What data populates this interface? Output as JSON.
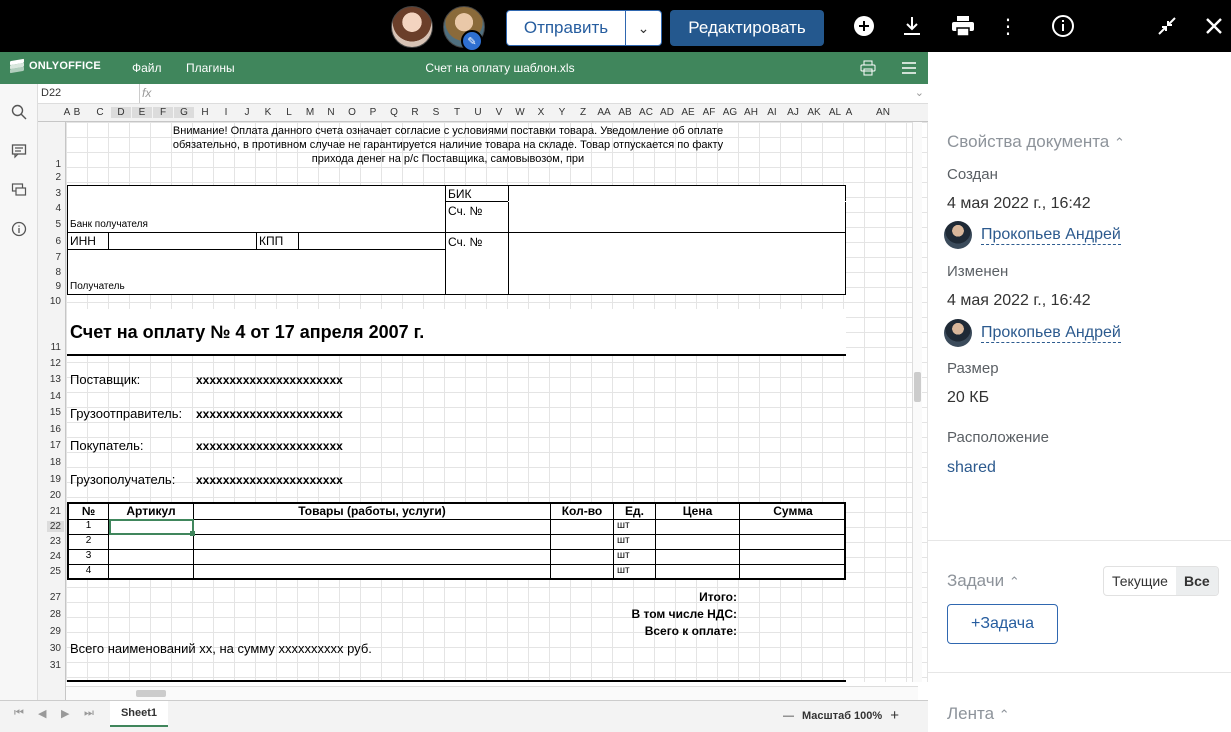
{
  "topbar": {
    "send_label": "Отправить",
    "edit_label": "Редактировать"
  },
  "editor": {
    "logo_text": "ONLYOFFICE",
    "menu": [
      "Файл",
      "Плагины"
    ],
    "doc_title": "Счет на оплату шаблон.xls",
    "cell_ref": "D22",
    "fx": "fx"
  },
  "columns": [
    "A",
    "B",
    "C",
    "D",
    "E",
    "F",
    "G",
    "H",
    "I",
    "J",
    "K",
    "L",
    "M",
    "N",
    "O",
    "P",
    "Q",
    "R",
    "S",
    "T",
    "U",
    "V",
    "W",
    "X",
    "Y",
    "Z",
    "AA",
    "AB",
    "AC",
    "AD",
    "AE",
    "AF",
    "AG",
    "AH",
    "AI",
    "AJ",
    "AK",
    "AL",
    "A",
    "AN"
  ],
  "rows": [
    "1",
    "2",
    "3",
    "4",
    "5",
    "6",
    "7",
    "8",
    "9",
    "10",
    "11",
    "12",
    "13",
    "14",
    "15",
    "16",
    "17",
    "18",
    "19",
    "20",
    "21",
    "22",
    "23",
    "24",
    "25",
    "27",
    "28",
    "29",
    "30",
    "31"
  ],
  "sheet": {
    "notice_1": "Внимание! Оплата данного счета означает согласие с условиями поставки товара. Уведомление об оплате",
    "notice_2": "обязательно, в противном случае не гарантируется наличие товара на складе. Товар отпускается по факту",
    "notice_3": "прихода денег на р/с Поставщика, самовывозом, при",
    "bik": "БИК",
    "sch1": "Сч. №",
    "bank": "Банк получателя",
    "inn": "ИНН",
    "kpp": "КПП",
    "sch2": "Сч. №",
    "recipient": "Получатель",
    "invoice_title": "Счет на оплату № 4 от 17 апреля 2007 г.",
    "supplier_label": "Поставщик:",
    "supplier_value": "xxxxxxxxxxxxxxxxxxxxxx",
    "shipper_label": "Грузоотправитель:",
    "shipper_value": "xxxxxxxxxxxxxxxxxxxxxx",
    "buyer_label": "Покупатель:",
    "buyer_value": "xxxxxxxxxxxxxxxxxxxxxx",
    "consignee_label": "Грузополучатель:",
    "consignee_value": "xxxxxxxxxxxxxxxxxxxxxx",
    "table_headers": [
      "№",
      "Артикул",
      "Товары (работы, услуги)",
      "Кол-во",
      "Ед.",
      "Цена",
      "Сумма"
    ],
    "table_rows": [
      {
        "n": "1",
        "unit": "шт"
      },
      {
        "n": "2",
        "unit": "шт"
      },
      {
        "n": "3",
        "unit": "шт"
      },
      {
        "n": "4",
        "unit": "шт"
      }
    ],
    "total": "Итого:",
    "vat": "В том числе НДС:",
    "grand_total": "Всего к оплате:",
    "summary": "Всего наименований xx, на сумму xxxxxxxxxx руб."
  },
  "statusbar": {
    "sheet_tab": "Sheet1",
    "zoom_label": "Масштаб 100%",
    "zoom_minus": "—",
    "zoom_plus": "+"
  },
  "panel": {
    "props_title": "Свойства документа",
    "created_label": "Создан",
    "created_value": "4 мая 2022 г., 16:42",
    "created_user": "Прокопьев Андрей",
    "modified_label": "Изменен",
    "modified_value": "4 мая 2022 г., 16:42",
    "modified_user": "Прокопьев Андрей",
    "size_label": "Размер",
    "size_value": "20 КБ",
    "location_label": "Расположение",
    "location_value": "shared",
    "tasks_title": "Задачи",
    "tasks_current": "Текущие",
    "tasks_all": "Все",
    "task_button": "+Задача",
    "feed_title": "Лента"
  }
}
